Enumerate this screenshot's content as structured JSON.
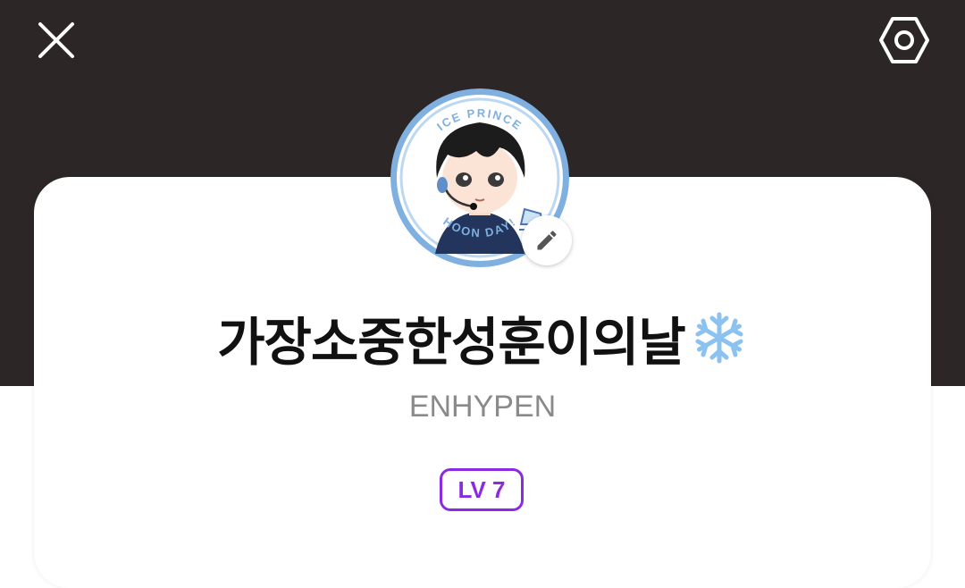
{
  "header": {
    "close_icon": "close-icon",
    "settings_icon": "gear-icon",
    "background_color": "#2c2627"
  },
  "profile": {
    "avatar": {
      "badge_top_text": "ICE PRINCE",
      "badge_bottom_text": "HOON DAY!"
    },
    "edit_icon": "pencil-icon",
    "nickname": "가장소중한성훈이의날",
    "nickname_emoji": "snowflake-icon",
    "artist": "ENHYPEN",
    "level": "LV 7",
    "level_color": "#8a2be2"
  }
}
